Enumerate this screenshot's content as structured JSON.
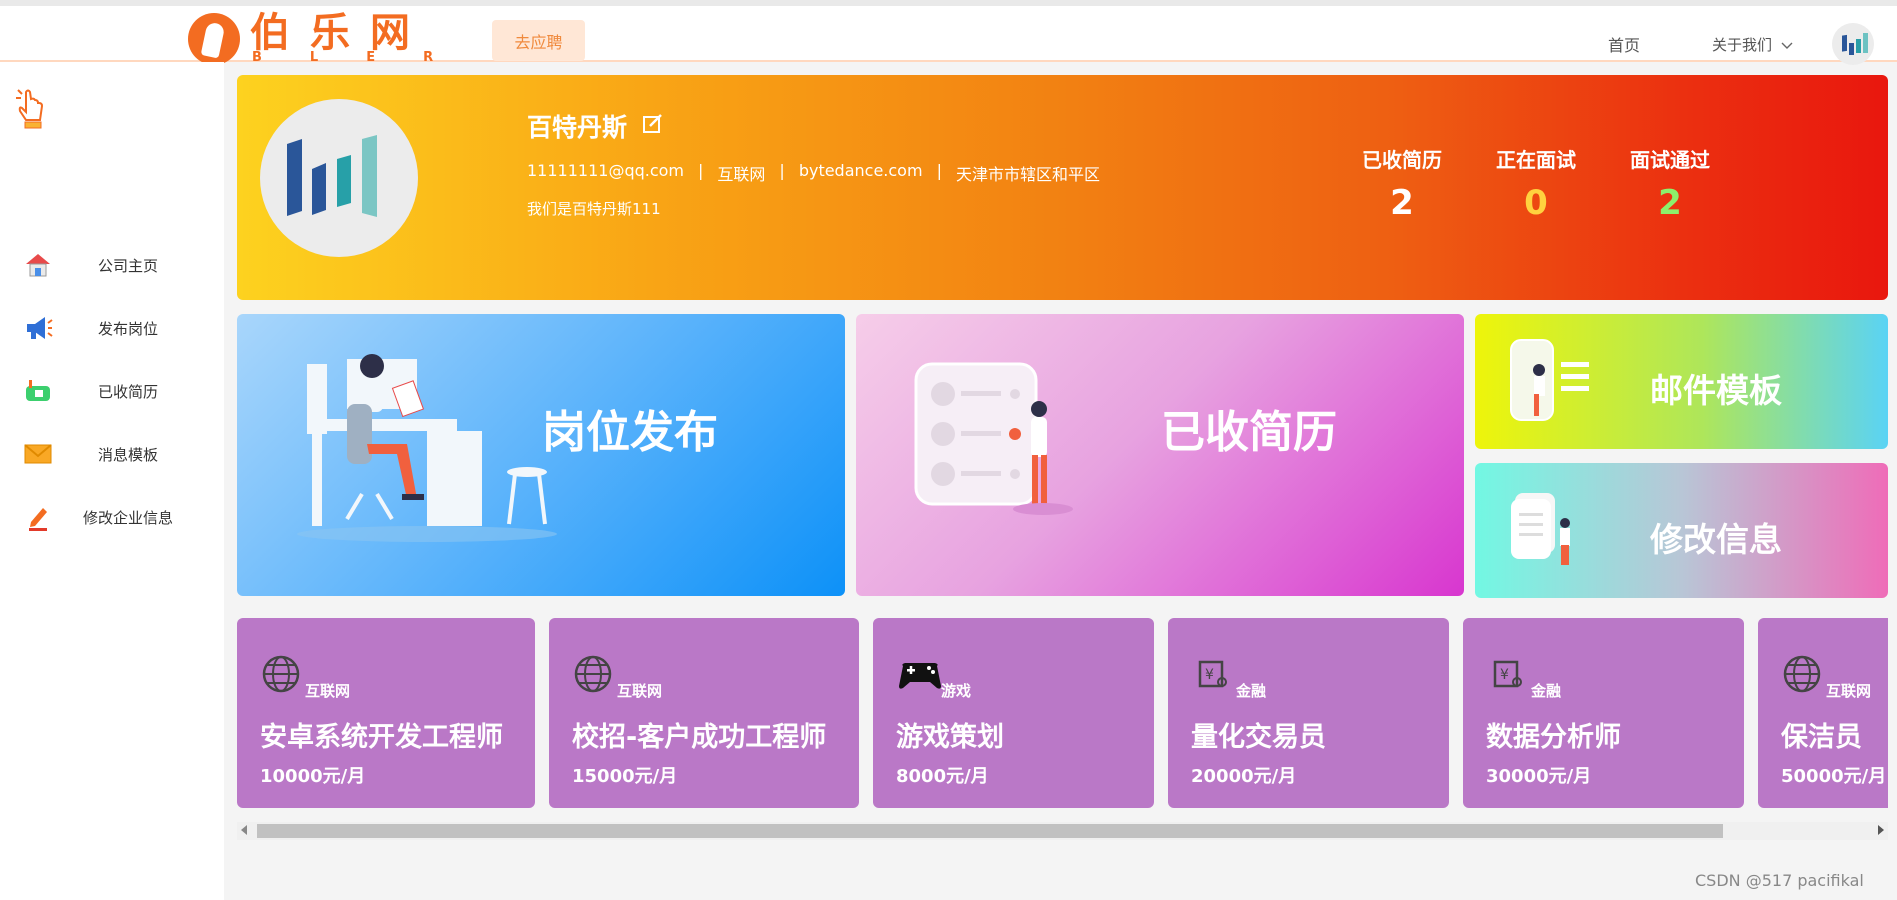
{
  "header": {
    "logo_text": "伯乐网",
    "logo_letters": "BLER",
    "apply_button": "去应聘",
    "nav_home": "首页",
    "nav_about": "关于我们"
  },
  "sidebar": {
    "items": [
      {
        "label": "公司主页",
        "icon": "house-icon"
      },
      {
        "label": "发布岗位",
        "icon": "megaphone-icon"
      },
      {
        "label": "已收简历",
        "icon": "mailbox-icon"
      },
      {
        "label": "消息模板",
        "icon": "envelope-icon"
      },
      {
        "label": "修改企业信息",
        "icon": "pencil-icon"
      }
    ]
  },
  "company": {
    "name": "百特丹斯",
    "email": "11111111@qq.com",
    "industry": "互联网",
    "website": "bytedance.com",
    "address": "天津市市辖区和平区",
    "separator": "|",
    "description": "我们是百特丹斯111"
  },
  "stats": [
    {
      "label": "已收简历",
      "value": "2",
      "color": "#ffffff"
    },
    {
      "label": "正在面试",
      "value": "0",
      "color": "#ffd23f"
    },
    {
      "label": "面试通过",
      "value": "2",
      "color": "#8df06b"
    }
  ],
  "cards": {
    "post_job": "岗位发布",
    "received_resumes": "已收简历",
    "mail_template": "邮件模板",
    "edit_info": "修改信息"
  },
  "jobs": [
    {
      "category": "互联网",
      "title": "安卓系统开发工程师",
      "salary": "10000元/月",
      "icon": "globe-icon"
    },
    {
      "category": "互联网",
      "title": "校招-客户成功工程师",
      "salary": "15000元/月",
      "icon": "globe-icon"
    },
    {
      "category": "游戏",
      "title": "游戏策划",
      "salary": "8000元/月",
      "icon": "gamepad-icon"
    },
    {
      "category": "金融",
      "title": "量化交易员",
      "salary": "20000元/月",
      "icon": "finance-icon"
    },
    {
      "category": "金融",
      "title": "数据分析师",
      "salary": "30000元/月",
      "icon": "finance-icon"
    },
    {
      "category": "互联网",
      "title": "保洁员",
      "salary": "50000元/月",
      "icon": "globe-icon"
    }
  ],
  "watermark": "CSDN @517 pacifikal"
}
